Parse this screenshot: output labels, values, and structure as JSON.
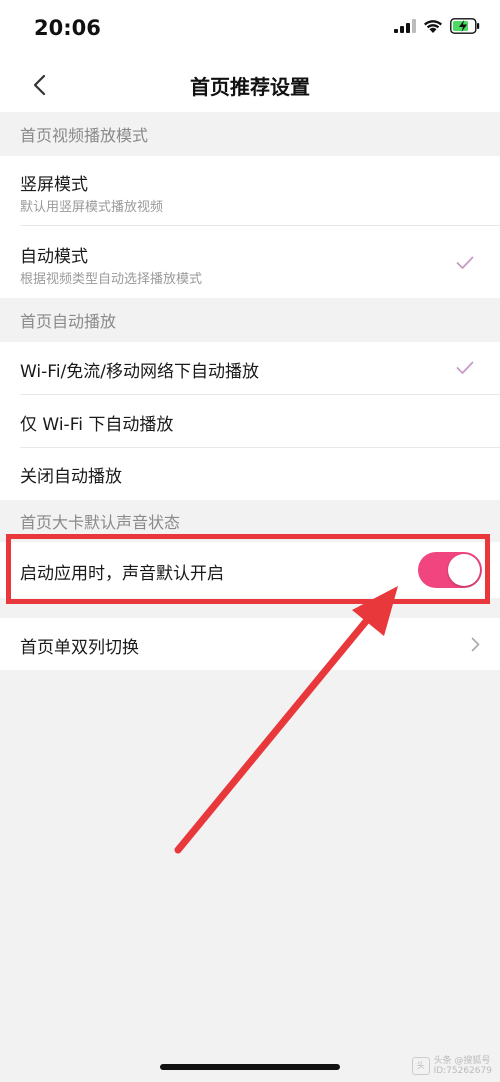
{
  "status": {
    "time": "20:06"
  },
  "nav": {
    "title": "首页推荐设置"
  },
  "sections": {
    "video_mode": {
      "header": "首页视频播放模式",
      "items": [
        {
          "title": "竖屏模式",
          "subtitle": "默认用竖屏模式播放视频",
          "checked": false
        },
        {
          "title": "自动模式",
          "subtitle": "根据视频类型自动选择播放模式",
          "checked": true
        }
      ]
    },
    "autoplay": {
      "header": "首页自动播放",
      "items": [
        {
          "title": "Wi-Fi/免流/移动网络下自动播放",
          "checked": true
        },
        {
          "title": "仅 Wi-Fi 下自动播放",
          "checked": false
        },
        {
          "title": "关闭自动播放",
          "checked": false
        }
      ]
    },
    "sound": {
      "header": "首页大卡默认声音状态",
      "toggle_label": "启动应用时，声音默认开启",
      "toggle_on": true
    },
    "layout": {
      "label": "首页单双列切换"
    }
  },
  "colors": {
    "accent": "#f0457e",
    "check": "#c89bc4",
    "highlight": "#e8383b"
  },
  "watermark": {
    "line1": "头条 @搜狐号",
    "line2": "ID:75262679"
  }
}
